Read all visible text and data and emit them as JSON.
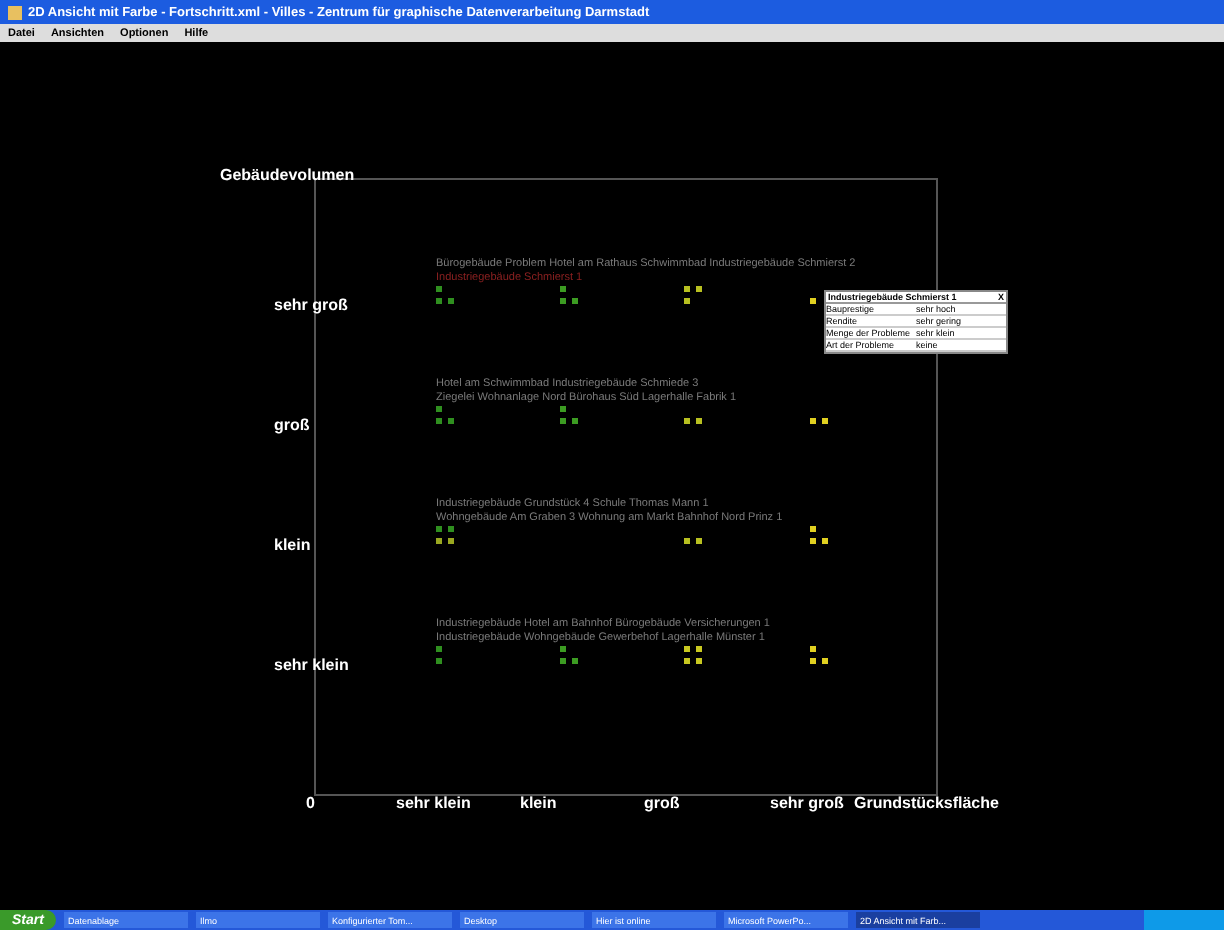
{
  "window": {
    "title": "2D Ansicht mit Farbe - Fortschritt.xml - Villes - Zentrum für graphische Datenverarbeitung Darmstadt"
  },
  "menu": [
    "Datei",
    "Ansichten",
    "Optionen",
    "Hilfe"
  ],
  "plot": {
    "y_axis_title": "Gebäudevolumen",
    "x_axis_title": "Grundstücksfläche",
    "origin": "0",
    "y_labels": [
      "sehr groß",
      "groß",
      "klein",
      "sehr klein"
    ],
    "x_labels": [
      "sehr klein",
      "klein",
      "groß",
      "sehr groß"
    ],
    "rows": [
      {
        "lines": [
          {
            "text": "Bürogebäude Problem  Hotel am Rathaus  Schwimmbad  Industriegebäude Schmierst 2",
            "color": "#7a7a7a"
          },
          {
            "text": "Industriegebäude Schmierst 1",
            "color": "#8a2020"
          }
        ],
        "cells": [
          {
            "top": [
              {
                "color": "#2f8f1f"
              }
            ],
            "bottom": [
              {
                "color": "#2f8f1f"
              },
              {
                "color": "#2f8f1f"
              }
            ]
          },
          {
            "top": [
              {
                "color": "#3c9c22"
              }
            ],
            "bottom": [
              {
                "color": "#3c9c22"
              },
              {
                "color": "#3c9c22"
              }
            ]
          },
          {
            "top": [
              {
                "color": "#b8c020"
              },
              {
                "color": "#b8c020"
              }
            ],
            "bottom": [
              {
                "color": "#b8c020"
              }
            ]
          },
          {
            "bottom": [
              {
                "color": "#e0d020"
              }
            ]
          }
        ]
      },
      {
        "lines": [
          {
            "text": "Hotel am Schwimmbad  Industriegebäude Schmiede 3",
            "color": "#7a7a7a"
          },
          {
            "text": "Ziegelei  Wohnanlage Nord  Bürohaus Süd  Lagerhalle Fabrik 1",
            "color": "#7a7a7a"
          }
        ],
        "cells": [
          {
            "top": [
              {
                "color": "#2f8f1f"
              }
            ],
            "bottom": [
              {
                "color": "#2f8f1f"
              },
              {
                "color": "#2f8f1f"
              }
            ]
          },
          {
            "top": [
              {
                "color": "#3c9c22"
              }
            ],
            "bottom": [
              {
                "color": "#3c9c22"
              },
              {
                "color": "#3c9c22"
              }
            ]
          },
          {
            "bottom": [
              {
                "color": "#b8c020"
              },
              {
                "color": "#b8c020"
              }
            ]
          },
          {
            "bottom": [
              {
                "color": "#e0d020"
              },
              {
                "color": "#e0d020"
              }
            ]
          }
        ]
      },
      {
        "lines": [
          {
            "text": "Industriegebäude Grundstück 4                                  Schule Thomas Mann 1",
            "color": "#7a7a7a"
          },
          {
            "text": "Wohngebäude Am Graben 3        Wohnung am Markt  Bahnhof Nord Prinz 1",
            "color": "#7a7a7a"
          }
        ],
        "cells": [
          {
            "top": [
              {
                "color": "#2f8f1f"
              },
              {
                "color": "#2f8f1f"
              }
            ],
            "bottom": [
              {
                "color": "#9aa820"
              },
              {
                "color": "#9aa820"
              }
            ]
          },
          {},
          {
            "bottom": [
              {
                "color": "#b8c020"
              },
              {
                "color": "#b8c020"
              }
            ]
          },
          {
            "top": [
              {
                "color": "#e0d020"
              }
            ],
            "bottom": [
              {
                "color": "#e0d020"
              },
              {
                "color": "#e0d020"
              }
            ]
          }
        ]
      },
      {
        "lines": [
          {
            "text": "Industriegebäude  Hotel am Bahnhof  Bürogebäude  Versicherungen 1",
            "color": "#7a7a7a"
          },
          {
            "text": "Industriegebäude  Wohngebäude  Gewerbehof  Lagerhalle Münster 1",
            "color": "#7a7a7a"
          }
        ],
        "cells": [
          {
            "top": [
              {
                "color": "#2f8f1f"
              }
            ],
            "bottom": [
              {
                "color": "#2f8f1f"
              }
            ]
          },
          {
            "top": [
              {
                "color": "#3c9c22"
              }
            ],
            "bottom": [
              {
                "color": "#3c9c22"
              },
              {
                "color": "#3c9c22"
              }
            ]
          },
          {
            "top": [
              {
                "color": "#c8c820"
              },
              {
                "color": "#c8c820"
              }
            ],
            "bottom": [
              {
                "color": "#c8c820"
              },
              {
                "color": "#c8c820"
              }
            ]
          },
          {
            "top": [
              {
                "color": "#e0d020"
              }
            ],
            "bottom": [
              {
                "color": "#e0d020"
              },
              {
                "color": "#e0d020"
              }
            ]
          }
        ]
      }
    ],
    "tooltip": {
      "title": "Industriegebäude Schmierst 1",
      "close": "X",
      "rows": [
        {
          "label": "Bauprestige",
          "value": "sehr hoch"
        },
        {
          "label": "Rendite",
          "value": "sehr gering"
        },
        {
          "label": "Menge der Probleme",
          "value": "sehr klein"
        },
        {
          "label": "Art der Probleme",
          "value": "keine"
        }
      ]
    }
  },
  "taskbar": {
    "start": "Start",
    "items": [
      {
        "label": "Datenablage",
        "selected": false
      },
      {
        "label": "Ilmo",
        "selected": false
      },
      {
        "label": "Konfigurierter Tom...",
        "selected": false
      },
      {
        "label": "Desktop",
        "selected": false
      },
      {
        "label": "Hier ist online",
        "selected": false
      },
      {
        "label": "Microsoft PowerPo...",
        "selected": false
      },
      {
        "label": "2D Ansicht mit Farb...",
        "selected": true
      }
    ]
  }
}
